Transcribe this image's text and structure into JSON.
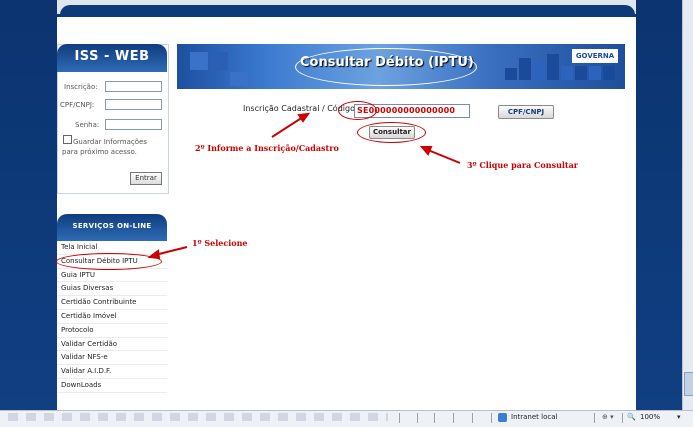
{
  "login": {
    "title": "ISS - WEB",
    "inscricao_label": "Inscrição:",
    "cpf_label": "CPF/CNPJ:",
    "senha_label": "Senha:",
    "remember_line1": "Guardar Informações",
    "remember_line2": "para próximo acesso.",
    "enter_button": "Entrar"
  },
  "services": {
    "title": "Serviços On-Line",
    "items": [
      "Tela Inicial",
      "Consultar Débito IPTU",
      "Guia IPTU",
      "Guias Diversas",
      "Certidão Contribuinte",
      "Certidão Imóvel",
      "Protocolo",
      "Validar Certidão",
      "Validar NFS-e",
      "Validar A.I.D.F.",
      "DownLoads"
    ]
  },
  "banner": {
    "title": "Consultar Débito (IPTU)",
    "logo_text": "GOVERNA"
  },
  "form": {
    "label": "Inscrição Cadastral / Código:",
    "value": "SE000000000000000",
    "cpf_button": "CPF/CNPJ",
    "submit_button": "Consultar"
  },
  "annotations": {
    "step1": "1º  Selecione",
    "step2": "2º Informe a Inscrição/Cadastro",
    "step3": "3º Clique para Consultar",
    "color": "#cc0000"
  },
  "status_bar": {
    "zone": "Intranet local",
    "zoom": "100%"
  }
}
